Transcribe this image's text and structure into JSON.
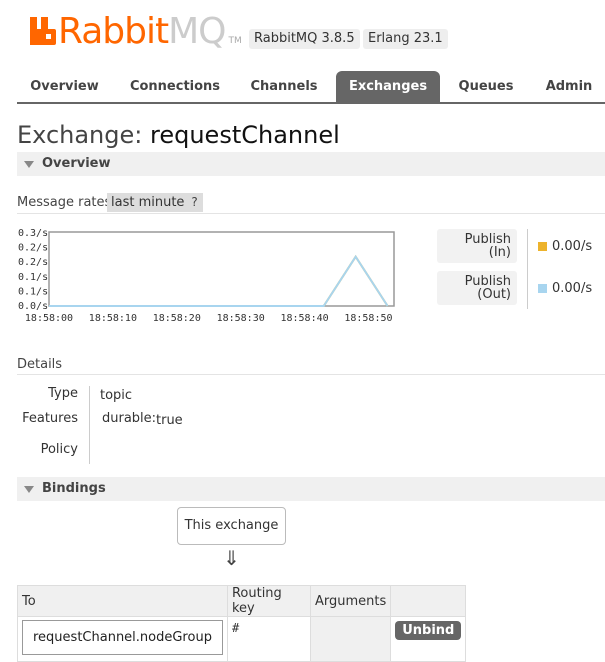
{
  "header": {
    "logo_text_main": "Rabbit",
    "logo_text_accent": "MQ",
    "logo_tm": "TM",
    "rabbitmq_version": "RabbitMQ 3.8.5",
    "erlang_version": "Erlang 23.1"
  },
  "tabs": [
    {
      "label": "Overview",
      "active": false
    },
    {
      "label": "Connections",
      "active": false
    },
    {
      "label": "Channels",
      "active": false
    },
    {
      "label": "Exchanges",
      "active": true
    },
    {
      "label": "Queues",
      "active": false
    },
    {
      "label": "Admin",
      "active": false
    }
  ],
  "page": {
    "title_prefix": "Exchange:",
    "exchange_name": "requestChannel"
  },
  "overview": {
    "section_label": "Overview",
    "message_rates_label": "Message rates",
    "rates_period": "last minute",
    "help_label": "?"
  },
  "chart_data": {
    "type": "line",
    "x": [
      "18:58:00",
      "18:58:10",
      "18:58:20",
      "18:58:30",
      "18:58:40",
      "18:58:50"
    ],
    "ytick_labels": [
      "0.3/s",
      "0.2/s",
      "0.2/s",
      "0.1/s",
      "0.1/s",
      "0.0/s"
    ],
    "ylim": [
      0,
      0.3
    ],
    "series": [
      {
        "name": "Publish (In)",
        "color": "#edb32c",
        "points": [
          [
            0,
            0
          ],
          [
            43,
            0
          ],
          [
            48,
            0.2
          ],
          [
            53,
            0
          ]
        ]
      },
      {
        "name": "Publish (Out)",
        "color": "#a8d5ef",
        "points": [
          [
            0,
            0
          ],
          [
            43,
            0
          ],
          [
            48,
            0.2
          ],
          [
            53,
            0
          ]
        ]
      }
    ],
    "legend": [
      {
        "label_line1": "Publish",
        "label_line2": "(In)",
        "value": "0.00/s",
        "color": "#edb32c"
      },
      {
        "label_line1": "Publish",
        "label_line2": "(Out)",
        "value": "0.00/s",
        "color": "#a8d5ef"
      }
    ]
  },
  "details": {
    "title": "Details",
    "type_label": "Type",
    "type_value": "topic",
    "features_label": "Features",
    "features_key": "durable:",
    "features_value": "true",
    "policy_label": "Policy"
  },
  "bindings": {
    "section_label": "Bindings",
    "this_exchange_label": "This exchange",
    "arrow": "⇓",
    "columns": [
      "To",
      "Routing key",
      "Arguments"
    ],
    "rows": [
      {
        "to": "requestChannel.nodeGroup",
        "routing_key": "#",
        "arguments": "",
        "action": "Unbind"
      }
    ]
  }
}
